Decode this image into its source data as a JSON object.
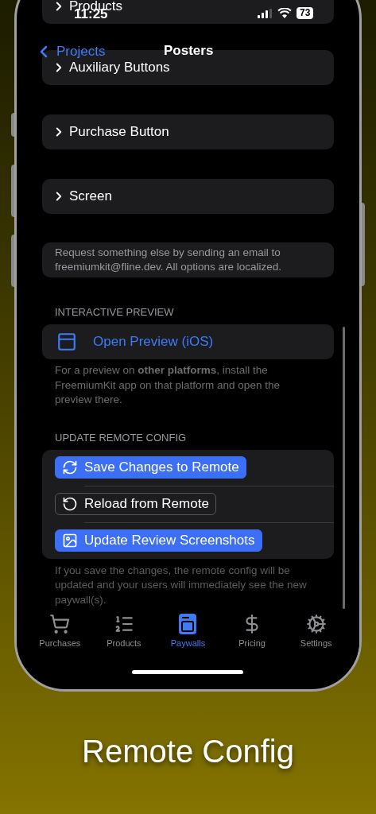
{
  "status_bar": {
    "time": "11:25",
    "battery": "73"
  },
  "nav": {
    "back": "Projects",
    "title": "Posters"
  },
  "collapsed_rows": [
    {
      "label": "Products"
    },
    {
      "label": "Auxiliary Buttons"
    },
    {
      "label": "Purchase Button"
    },
    {
      "label": "Screen"
    }
  ],
  "note": "Request something else by sending an email to freemiumkit@fline.dev. All options are localized.",
  "preview": {
    "header": "INTERACTIVE PREVIEW",
    "button": "Open Preview (iOS)",
    "footer": "For a preview on **other platforms**, install the FreemiumKit app on that platform and open the preview there."
  },
  "remote": {
    "header": "UPDATE REMOTE CONFIG",
    "buttons": [
      {
        "label": "Save Changes to Remote",
        "kind": "filled"
      },
      {
        "label": "Reload from Remote",
        "kind": "outlined"
      },
      {
        "label": "Update Review Screenshots",
        "kind": "filled"
      }
    ],
    "footer": "If you save the changes, the remote config will be updated and your users will immediately see the new paywall(s)."
  },
  "tabs": [
    {
      "label": "Purchases",
      "selected": false
    },
    {
      "label": "Products",
      "selected": false
    },
    {
      "label": "Paywalls",
      "selected": true
    },
    {
      "label": "Pricing",
      "selected": false
    },
    {
      "label": "Settings",
      "selected": false
    }
  ],
  "caption": "Remote Config"
}
